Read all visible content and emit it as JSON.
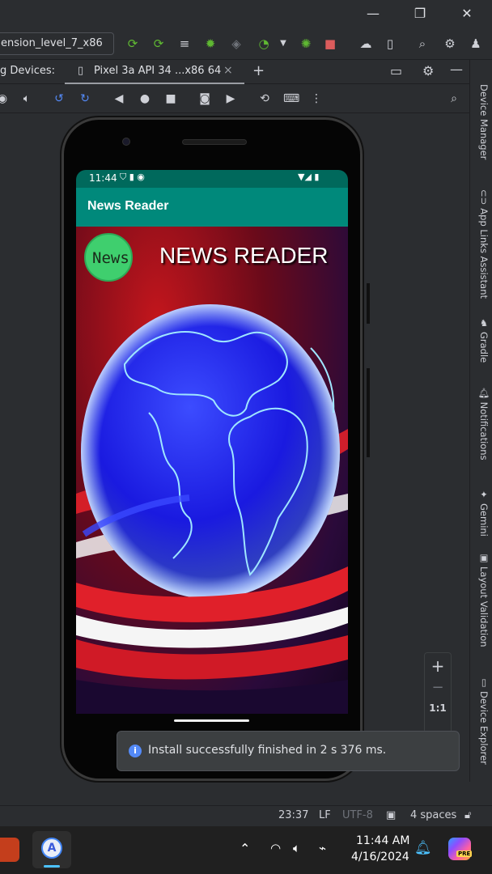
{
  "titlebar": {
    "minimize": "—",
    "restore": "❐",
    "close": "✕"
  },
  "toolbar": {
    "run_config": "ension_level_7_x86"
  },
  "running_devices": {
    "label": "g Devices:",
    "tab_label": "Pixel 3a API 34 ...x86 64",
    "tab_close": "×",
    "add": "+"
  },
  "right_sidebar": {
    "items": [
      "Device Manager",
      "App Links Assistant",
      "Gradle",
      "Notifications",
      "Gemini",
      "Layout Validation",
      "Device Explorer"
    ]
  },
  "phone": {
    "status_time": "11:44",
    "app_title": "News Reader",
    "headline": "NEWS READER",
    "badge_text": "News"
  },
  "zoom": {
    "plus": "+",
    "minus": "−",
    "one_to_one": "1:1"
  },
  "toast": {
    "icon": "i",
    "message": "Install successfully finished in 2 s 376 ms."
  },
  "ide_status": {
    "position": "23:37",
    "line_sep": "LF",
    "encoding": "UTF-8",
    "indent": "4 spaces"
  },
  "taskbar": {
    "time": "11:44 AM",
    "date": "4/16/2024",
    "copilot_badge": "PRE"
  }
}
